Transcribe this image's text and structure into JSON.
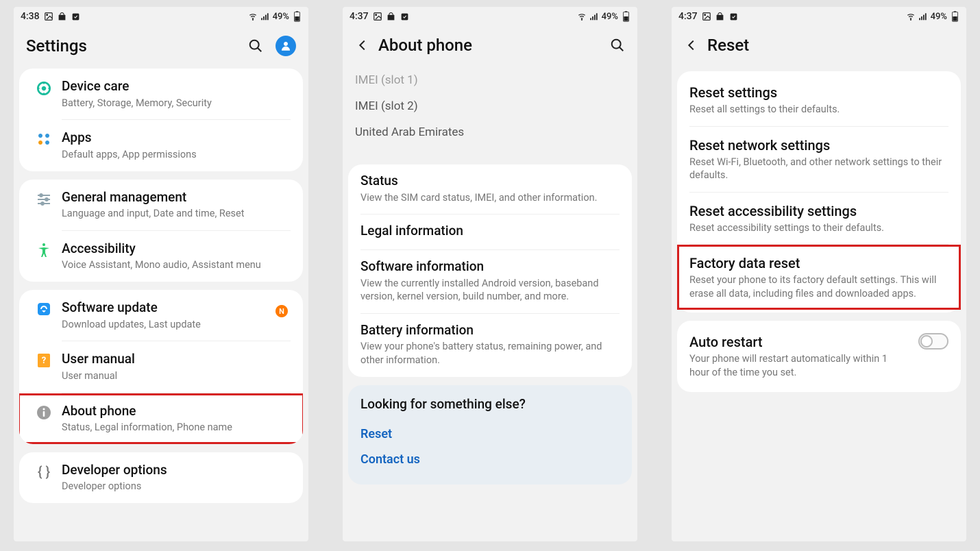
{
  "screen1": {
    "time": "4:38",
    "battery": "49%",
    "header_title": "Settings",
    "groups": [
      {
        "id": "g1",
        "items": [
          {
            "id": "device-care",
            "title": "Device care",
            "sub": "Battery, Storage, Memory, Security",
            "icon": "device-care-icon"
          },
          {
            "id": "apps",
            "title": "Apps",
            "sub": "Default apps, App permissions",
            "icon": "apps-icon"
          }
        ]
      },
      {
        "id": "g2",
        "items": [
          {
            "id": "general-management",
            "title": "General management",
            "sub": "Language and input, Date and time, Reset",
            "icon": "sliders-icon"
          },
          {
            "id": "accessibility",
            "title": "Accessibility",
            "sub": "Voice Assistant, Mono audio, Assistant menu",
            "icon": "accessibility-icon"
          }
        ]
      },
      {
        "id": "g3",
        "items": [
          {
            "id": "software-update",
            "title": "Software update",
            "sub": "Download updates, Last update",
            "icon": "update-icon",
            "badge": "N"
          },
          {
            "id": "user-manual",
            "title": "User manual",
            "sub": "User manual",
            "icon": "manual-icon"
          },
          {
            "id": "about-phone",
            "title": "About phone",
            "sub": "Status, Legal information, Phone name",
            "icon": "info-icon",
            "highlight": true
          }
        ]
      },
      {
        "id": "g4",
        "items": [
          {
            "id": "developer-options",
            "title": "Developer options",
            "sub": "Developer options",
            "icon": "braces-icon"
          }
        ]
      }
    ]
  },
  "screen2": {
    "time": "4:37",
    "battery": "49%",
    "header_title": "About phone",
    "top_lines": [
      "IMEI (slot 1)",
      "IMEI (slot 2)",
      "United Arab Emirates"
    ],
    "sections": [
      {
        "id": "status",
        "title": "Status",
        "sub": "View the SIM card status, IMEI, and other information."
      },
      {
        "id": "legal",
        "title": "Legal information",
        "sub": ""
      },
      {
        "id": "software",
        "title": "Software information",
        "sub": "View the currently installed Android version, baseband version, kernel version, build number, and more."
      },
      {
        "id": "battery-info",
        "title": "Battery information",
        "sub": "View your phone's battery status, remaining power, and other information."
      }
    ],
    "looking_title": "Looking for something else?",
    "reset_link": "Reset",
    "contact_link": "Contact us"
  },
  "screen3": {
    "time": "4:37",
    "battery": "49%",
    "header_title": "Reset",
    "options": [
      {
        "id": "reset-settings",
        "title": "Reset settings",
        "sub": "Reset all settings to their defaults."
      },
      {
        "id": "reset-network",
        "title": "Reset network settings",
        "sub": "Reset Wi-Fi, Bluetooth, and other network settings to their defaults."
      },
      {
        "id": "reset-accessibility",
        "title": "Reset accessibility settings",
        "sub": "Reset accessibility settings to their defaults."
      },
      {
        "id": "factory-reset",
        "title": "Factory data reset",
        "sub": "Reset your phone to its factory default settings. This will erase all data, including files and downloaded apps.",
        "highlight": true
      }
    ],
    "auto_restart": {
      "title": "Auto restart",
      "sub": "Your phone will restart automatically within 1 hour of the time you set."
    }
  },
  "icons": {
    "N": "N"
  }
}
